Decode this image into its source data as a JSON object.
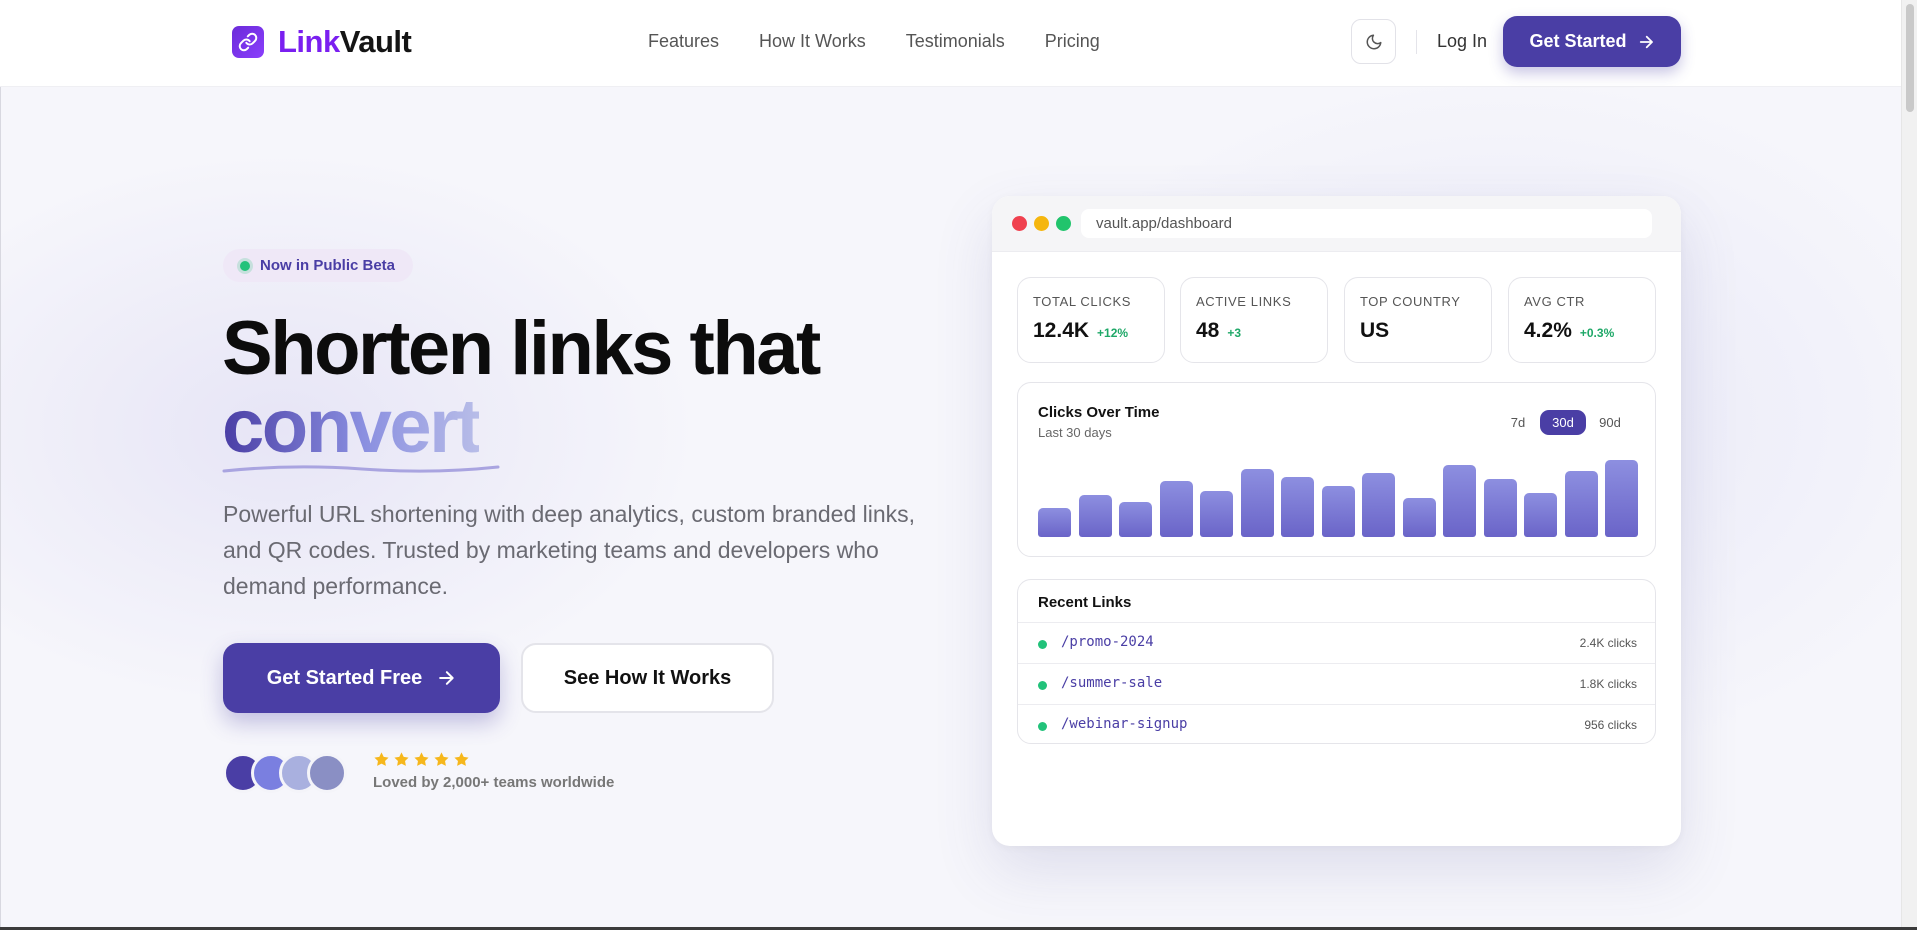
{
  "nav": {
    "brand_part1": "Link",
    "brand_part2": "Vault",
    "links": [
      "Features",
      "How It Works",
      "Testimonials",
      "Pricing"
    ],
    "login": "Log In",
    "cta": "Get Started",
    "icons": {
      "logo": "link-icon",
      "theme": "moon-icon",
      "cta": "arrow-right-icon"
    }
  },
  "hero": {
    "badge": "Now in Public Beta",
    "headline_line1": "Shorten links that",
    "headline_line2": "convert",
    "subtitle": "Powerful URL shortening with deep analytics, custom branded links, and QR codes. Trusted by marketing teams and developers who demand performance.",
    "primary_cta": "Get Started Free",
    "secondary_cta": "See How It Works",
    "rating_stars": 5,
    "social_proof": "Loved by 2,000+ teams worldwide",
    "avatar_colors": [
      "#4a3ea5",
      "#7a7fe0",
      "#a9b0df",
      "#8a8fc4"
    ]
  },
  "dashboard": {
    "url": "vault.app/dashboard",
    "stats": [
      {
        "label": "TOTAL CLICKS",
        "value": "12.4K",
        "change": "+12%"
      },
      {
        "label": "ACTIVE LINKS",
        "value": "48",
        "change": "+3"
      },
      {
        "label": "TOP COUNTRY",
        "value": "US",
        "change": ""
      },
      {
        "label": "AVG CTR",
        "value": "4.2%",
        "change": "+0.3%"
      }
    ],
    "chart": {
      "title": "Clicks Over Time",
      "subtitle": "Last 30 days",
      "ranges": [
        "7d",
        "30d",
        "90d"
      ],
      "active_range": "30d"
    },
    "recent_links_title": "Recent Links",
    "recent_links": [
      {
        "slug": "/promo-2024",
        "clicks": "2.4K clicks"
      },
      {
        "slug": "/summer-sale",
        "clicks": "1.8K clicks"
      },
      {
        "slug": "/webinar-signup",
        "clicks": "956 clicks"
      }
    ]
  },
  "colors": {
    "brand": "#4a3ea5",
    "logo": "#7a1ff0",
    "success": "#22c27a",
    "traffic_red": "#f0414f",
    "traffic_yellow": "#f5b60e",
    "traffic_green": "#21c46c",
    "star": "#f6b71c"
  },
  "chart_data": {
    "type": "bar",
    "values": [
      28,
      40,
      33,
      53,
      44,
      65,
      57,
      49,
      61,
      37,
      69,
      55,
      42,
      63,
      73
    ],
    "ylim": [
      0,
      80
    ],
    "grid": false
  }
}
